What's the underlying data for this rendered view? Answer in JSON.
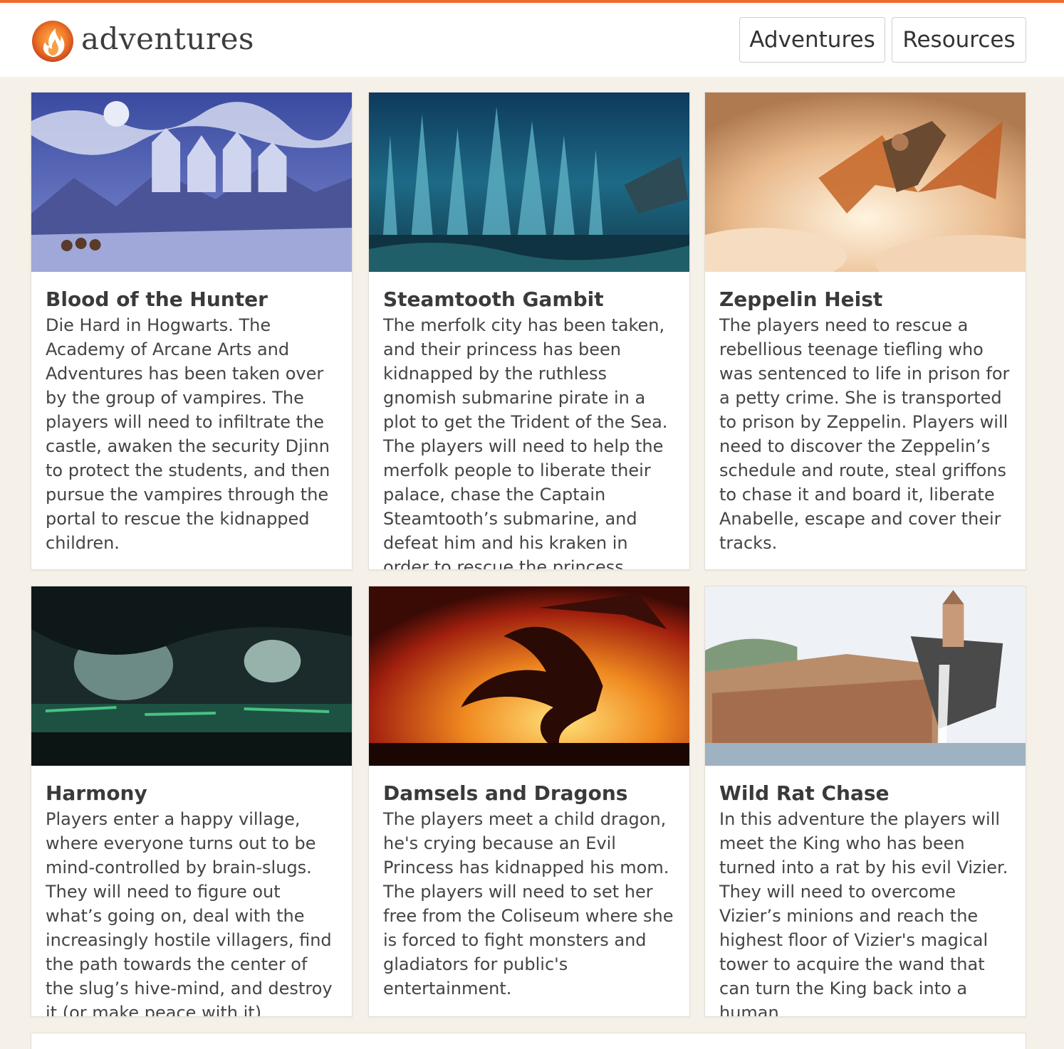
{
  "site": {
    "brand": "adventures",
    "logo_icon": "flame-logo-icon",
    "accent_color": "#ee6a2c"
  },
  "nav": {
    "adventures_label": "Adventures",
    "resources_label": "Resources"
  },
  "cards": [
    {
      "title": "Blood of the Hunter",
      "description": "Die Hard in Hogwarts. The Academy of Arcane Arts and Adventures has been taken over by the group of vampires. The players will need to infiltrate the castle, awaken the security Djinn to protect the students, and then pursue the vampires through the portal to rescue the kidnapped children."
    },
    {
      "title": "Steamtooth Gambit",
      "description": "The merfolk city has been taken, and their princess has been kidnapped by the ruthless gnomish submarine pirate in a plot to get the Trident of the Sea. The players will need to help the merfolk people to liberate their palace, chase the Captain Steamtooth’s submarine, and defeat him and his kraken in order to rescue the princess."
    },
    {
      "title": "Zeppelin Heist",
      "description": "The players need to rescue a rebellious teenage tiefling who was sentenced to life in prison for a petty crime. She is transported to prison by Zeppelin. Players will need to discover the Zeppelin’s schedule and route, steal griffons to chase it and board it, liberate Anabelle, escape and cover their tracks."
    },
    {
      "title": "Harmony",
      "description": "Players enter a happy village, where everyone turns out to be mind-controlled by brain-slugs. They will need to figure out what’s going on, deal with the increasingly hostile villagers, find the path towards the center of the slug’s hive-mind, and destroy it (or make peace with it)."
    },
    {
      "title": "Damsels and Dragons",
      "description": "The players meet a child dragon, he's crying because an Evil Princess has kidnapped his mom. The players will need to set her free from the Coliseum where she is forced to fight monsters and gladiators for public's entertainment."
    },
    {
      "title": "Wild Rat Chase",
      "description": "In this adventure the players will meet the King who has been turned into a rat by his evil Vizier. They will need to overcome Vizier’s minions and reach the highest floor of Vizier's magical tower to acquire the wand that can turn the King back into a human."
    }
  ]
}
